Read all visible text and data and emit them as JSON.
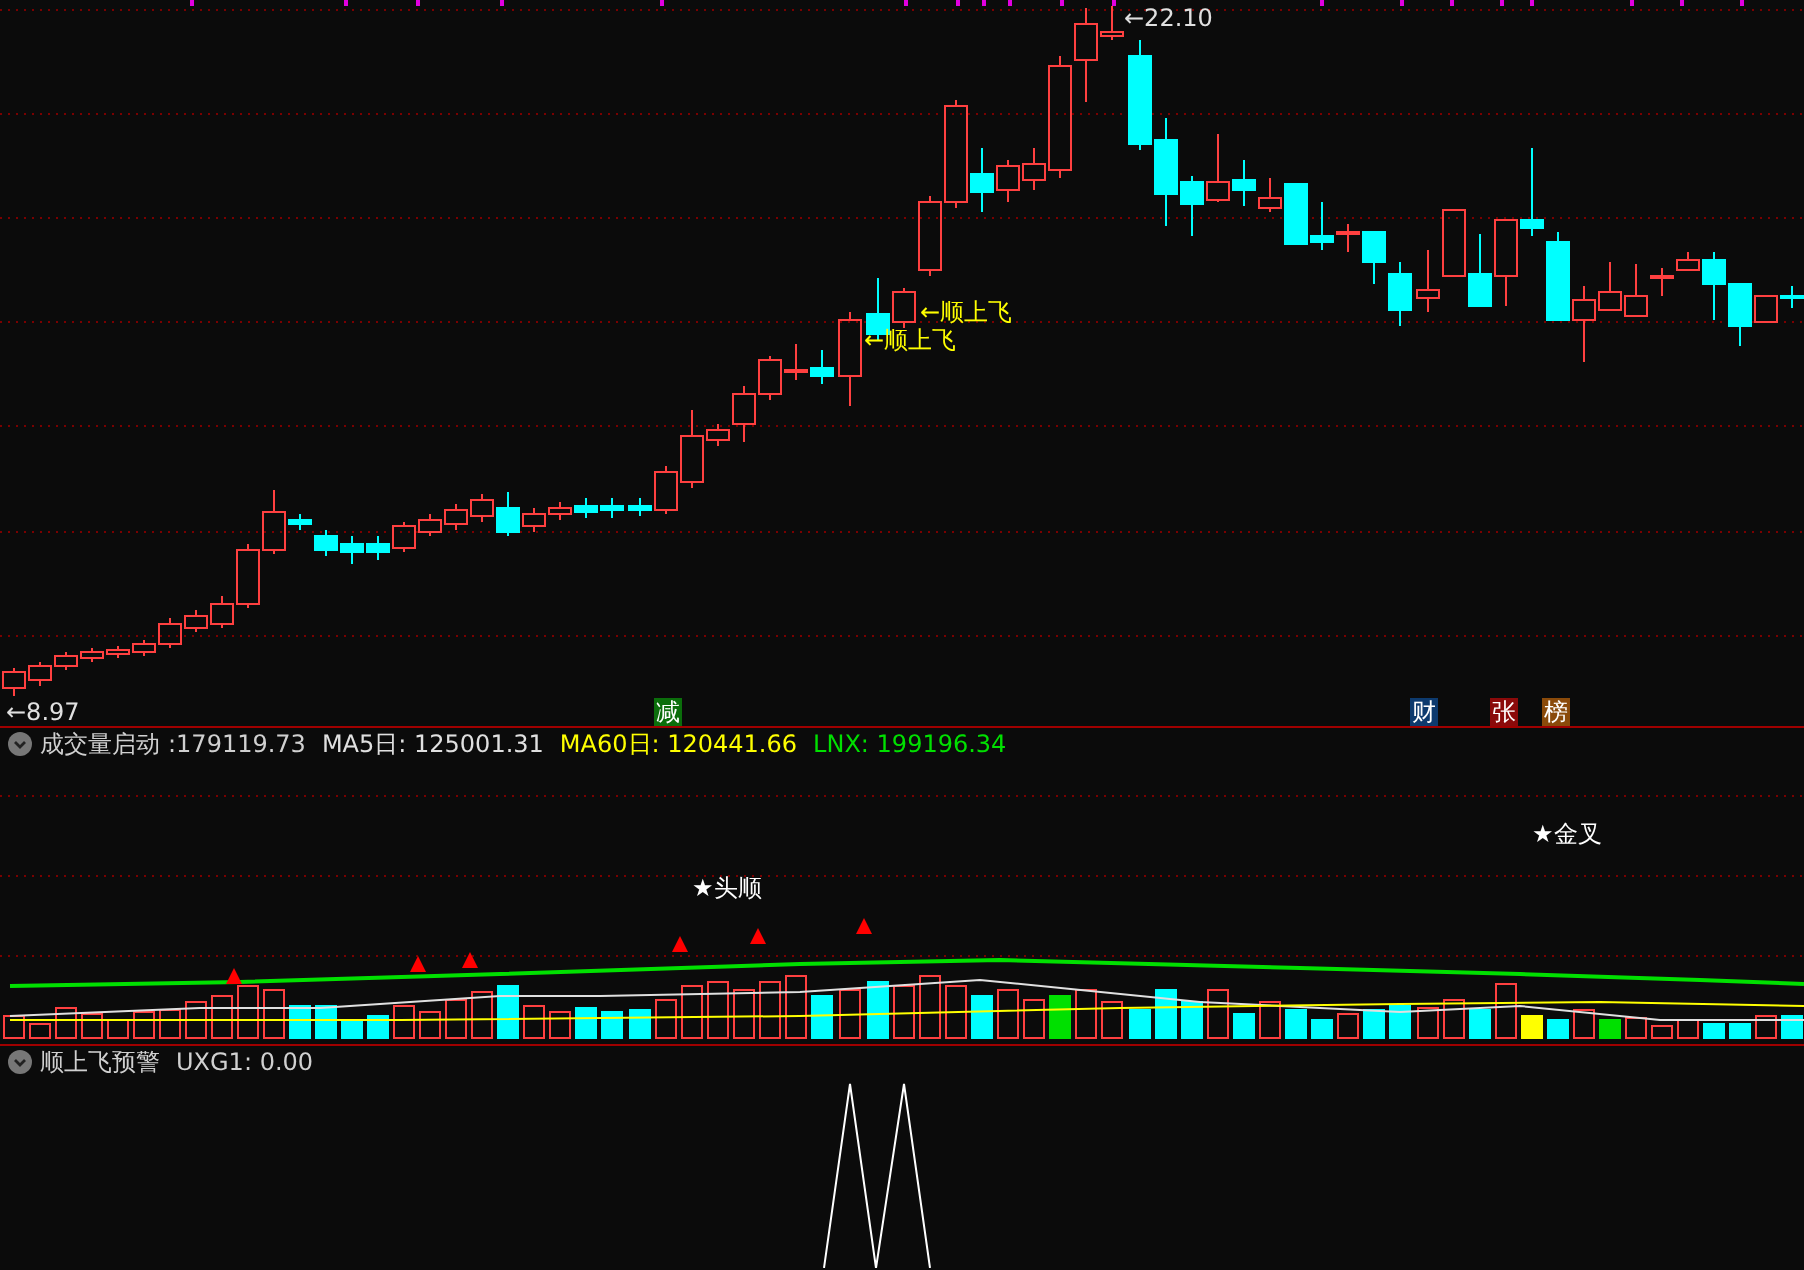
{
  "main_chart": {
    "price_labels": [
      {
        "text": "←8.97"
      },
      {
        "text": "←22.10"
      }
    ],
    "signals": [
      {
        "text": "←顺上飞"
      },
      {
        "text": "←顺上飞"
      }
    ],
    "badges": [
      {
        "text": "减",
        "color": "#0b6e0b"
      },
      {
        "text": "财",
        "color": "#0d3a6e"
      },
      {
        "text": "张",
        "color": "#8b0a0a"
      },
      {
        "text": "榜",
        "color": "#8a4a0a"
      }
    ]
  },
  "volume_panel": {
    "title": "成交量启动",
    "value": ":179119.73",
    "indicators": [
      {
        "label": "MA5日:",
        "value": "125001.31",
        "color": "#e0e0e0"
      },
      {
        "label": "MA60日:",
        "value": "120441.66",
        "color": "#ffff00"
      },
      {
        "label": "LNX:",
        "value": "199196.34",
        "color": "#00e000"
      }
    ],
    "markers": [
      {
        "text": "★头顺"
      },
      {
        "text": "★金叉"
      }
    ]
  },
  "alert_panel": {
    "title": "顺上飞预警",
    "indicators": [
      {
        "label": "UXG1:",
        "value": "0.00"
      }
    ]
  }
}
